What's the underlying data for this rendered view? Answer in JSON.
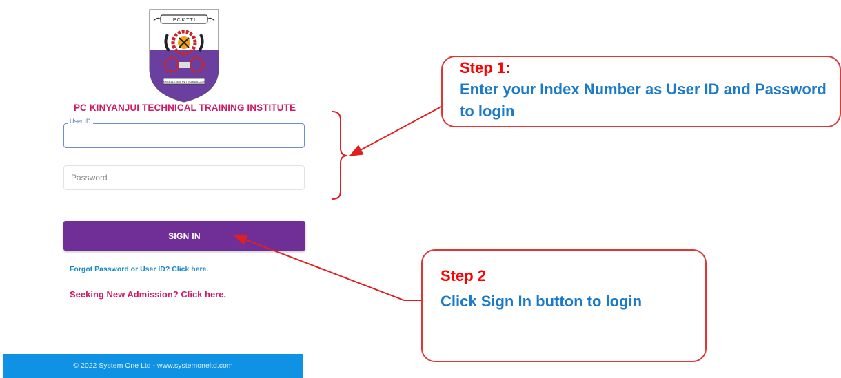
{
  "logo": {
    "banner_text": "P.C.K.T.T.I",
    "motto": "EXCELLENCE IN TECHNOLOGY",
    "colors": {
      "shield_top": "#ffffff",
      "shield_bottom": "#6b3fa0",
      "gear": "#c9252b",
      "sun": "#f2a21a"
    }
  },
  "institute_name": "PC KINYANJUI TECHNICAL TRAINING INSTITUTE",
  "login_form": {
    "user_id_label": "User ID",
    "user_id_value": "",
    "password_placeholder": "Password",
    "password_value": "",
    "signin_label": "SIGN IN",
    "forgot_link": "Forgot Password or User ID? Click here.",
    "admission_link": "Seeking New Admission? Click here."
  },
  "footer": {
    "text": "© 2022 System One Ltd - www.systemoneltd.com"
  },
  "annotations": {
    "step1": {
      "title": "Step 1:",
      "body": "Enter your Index Number as User ID and Password to login"
    },
    "step2": {
      "title": "Step 2",
      "body": "Click Sign In button to login"
    },
    "colors": {
      "arrow": "#e02020",
      "title": "#ff0000",
      "body": "#1b7ac9"
    }
  }
}
